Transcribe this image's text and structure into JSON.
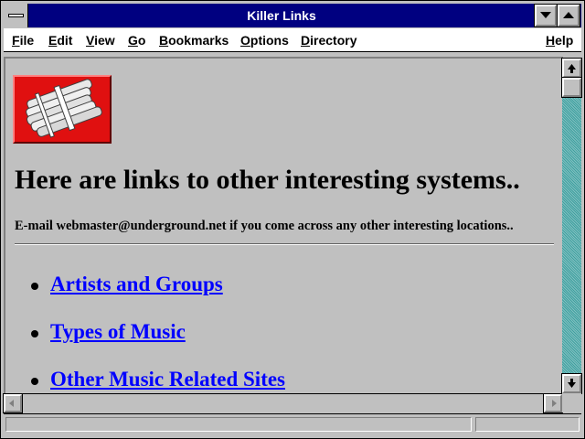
{
  "window": {
    "title": "Killer Links"
  },
  "menu": {
    "items": [
      {
        "label": "File"
      },
      {
        "label": "Edit"
      },
      {
        "label": "View"
      },
      {
        "label": "Go"
      },
      {
        "label": "Bookmarks"
      },
      {
        "label": "Options"
      },
      {
        "label": "Directory"
      },
      {
        "label": "Help"
      }
    ]
  },
  "page": {
    "logo_icon": "dynamite-bundle-icon",
    "heading": "Here are links to other interesting systems..",
    "email_text": "E-mail webmaster@underground.net if you come across any other interesting locations..",
    "links": [
      {
        "label": "Artists and Groups"
      },
      {
        "label": "Types of Music"
      },
      {
        "label": "Other Music Related Sites"
      }
    ]
  },
  "colors": {
    "titlebar": "#000080",
    "link": "#0000ff",
    "background": "#c0c0c0",
    "logo_bg": "#e01010"
  }
}
